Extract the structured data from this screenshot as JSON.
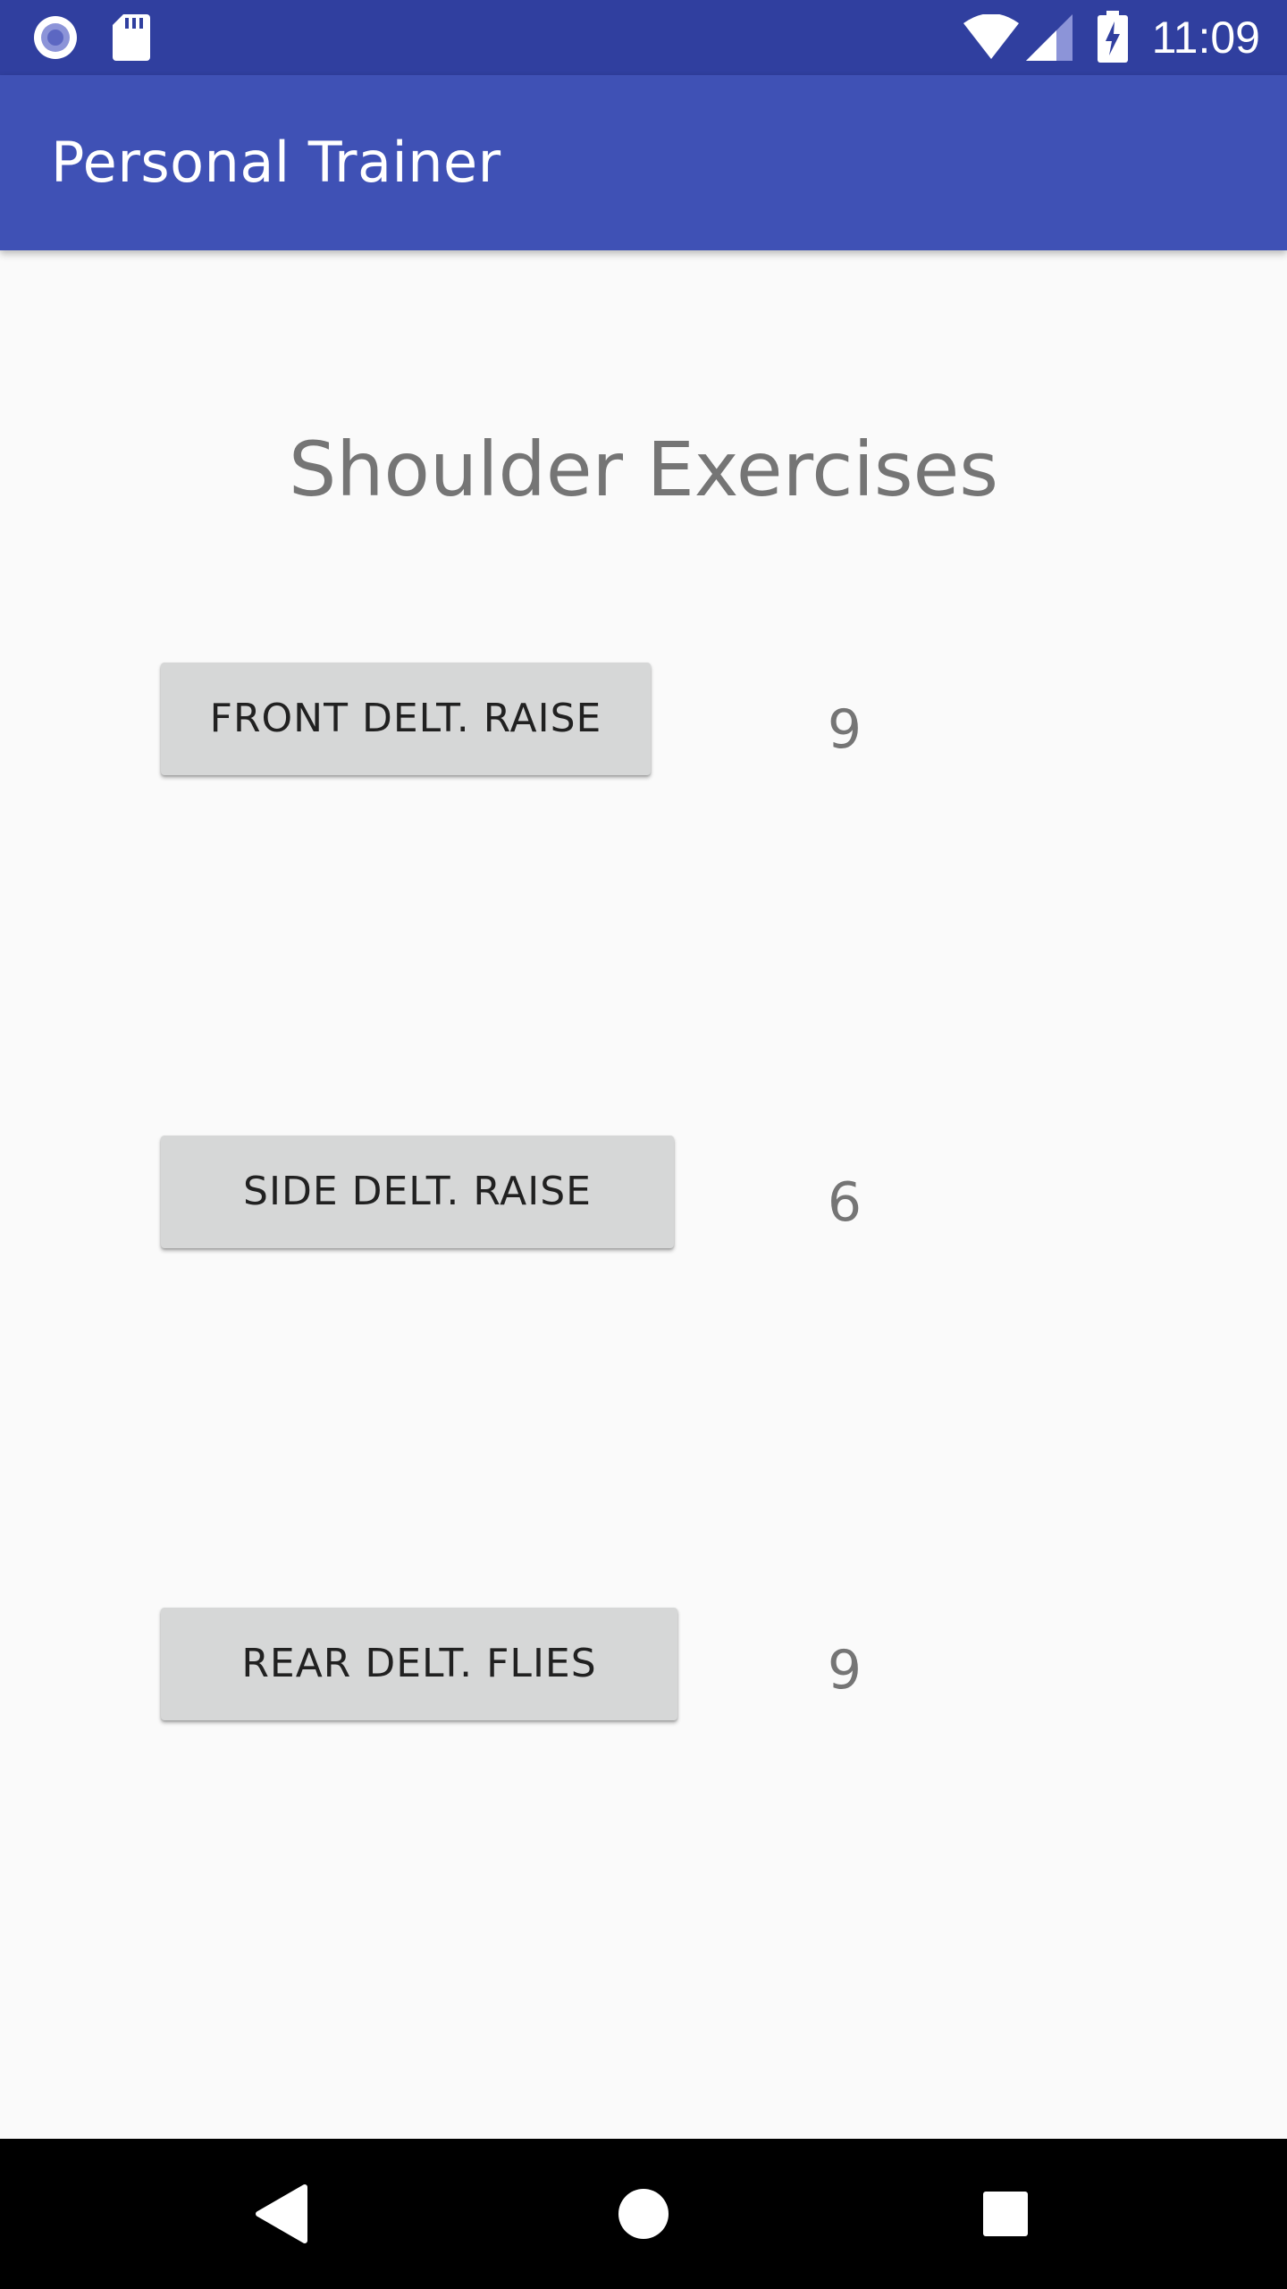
{
  "status_bar": {
    "time": "11:09",
    "icons": [
      "notification-circle-icon",
      "sd-card-icon",
      "wifi-icon",
      "cell-signal-icon",
      "battery-charging-icon"
    ]
  },
  "app_bar": {
    "title": "Personal Trainer",
    "color": "#3f51b5",
    "status_color": "#303f9f"
  },
  "main": {
    "heading": "Shoulder Exercises",
    "exercises": [
      {
        "label": "FRONT DELT. RAISE",
        "count": "9"
      },
      {
        "label": "SIDE DELT. RAISE",
        "count": "6"
      },
      {
        "label": "REAR DELT. FLIES",
        "count": "9"
      }
    ]
  },
  "nav_bar": {
    "buttons": [
      "back-icon",
      "home-icon",
      "recents-icon"
    ]
  }
}
